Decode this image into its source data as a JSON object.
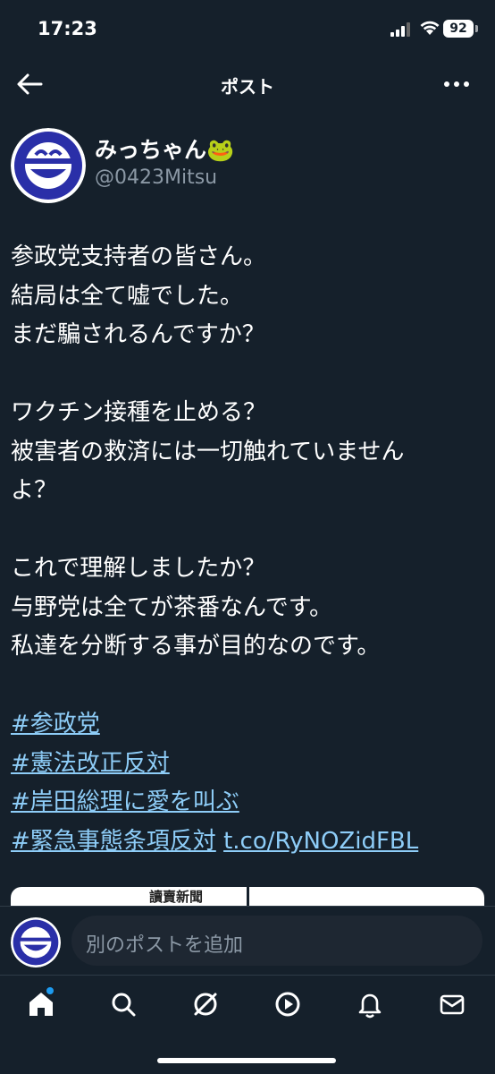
{
  "status": {
    "time": "17:23",
    "battery": "92"
  },
  "nav": {
    "title": "ポスト"
  },
  "post": {
    "display_name": "みっちゃん🐸",
    "handle": "@0423Mitsu",
    "lines": [
      "参政党支持者の皆さん。",
      "結局は全て嘘でした。",
      "まだ騙されるんですか？",
      "",
      "ワクチン接種を止める？",
      "被害者の救済には一切触れていません",
      "よ？",
      "",
      "これで理解しましたか？",
      "与野党は全てが茶番なんです。",
      "私達を分断する事が目的なのです。",
      ""
    ],
    "hashtags": [
      "#参政党",
      "#憲法改正反対",
      "#岸田総理に愛を叫ぶ",
      "#緊急事態条項反対"
    ],
    "link": "t.co/RyNOZidFBL",
    "media_text": "讀賣新聞"
  },
  "compose": {
    "placeholder": "別のポストを追加"
  },
  "colors": {
    "background": "#15202b",
    "link": "#8ecdf8",
    "accent": "#1d9bf0",
    "secondary_text": "#8b98a5"
  },
  "tabbar": {
    "items": [
      "home-icon",
      "search-icon",
      "grok-icon",
      "video-icon",
      "bell-icon",
      "mail-icon"
    ]
  }
}
